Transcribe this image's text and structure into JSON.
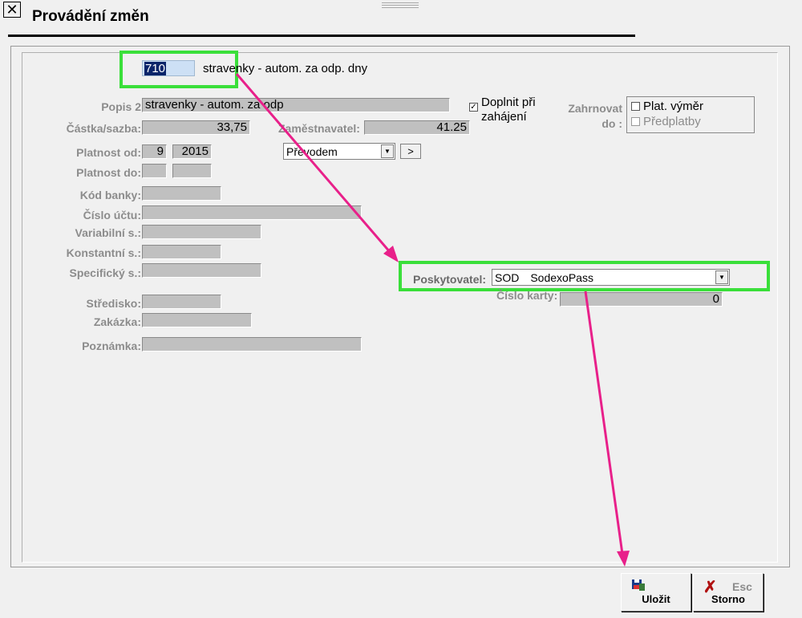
{
  "window": {
    "title": "Provádění změn",
    "close_glyph": "✕"
  },
  "form": {
    "code": "710",
    "code_desc": "stravenky - autom. za odp. dny",
    "popis2_label": "Popis 2",
    "popis2_value": "stravenky - autom. za odp",
    "castka_label": "Částka/sazba:",
    "castka_value": "33,75",
    "zamestnavatel_label": "Zaměstnavatel:",
    "zamestnavatel_value": "41.25",
    "platnost_od_label": "Platnost od:",
    "platnost_od_month": "9",
    "platnost_od_year": "2015",
    "platnost_do_label": "Platnost do:",
    "platnost_do_month": "",
    "platnost_do_year": "",
    "payment_select": "Převodem",
    "next_btn": ">",
    "doplnit_label_1": "Doplnit při",
    "doplnit_label_2": "zahájení",
    "doplnit_checked": "✓",
    "zahrnovat_label_1": "Zahrnovat",
    "zahrnovat_label_2": "do :",
    "plat_vymer": "Plat. výměr",
    "predplatby": "Předplatby",
    "kod_banky_label": "Kód banky:",
    "cislo_uctu_label": "Číslo účtu:",
    "variabilni_label": "Variabilní s.:",
    "konstantni_label": "Konstantní s.:",
    "specificky_label": "Specifický s.:",
    "stredisko_label": "Středisko:",
    "zakazka_label": "Zakázka:",
    "poznamka_label": "Poznámka:",
    "poskytovatel_label": "Poskytovatel:",
    "poskytovatel_code": "SOD",
    "poskytovatel_name": "SodexoPass",
    "cislo_karty_label": "Číslo karty:",
    "cislo_karty_value": "0"
  },
  "buttons": {
    "save": "Uložit",
    "cancel": "Storno",
    "cancel_hotkey": "Esc"
  },
  "colors": {
    "highlight": "#3adf3a",
    "arrow": "#e8208a",
    "field": "#c0c0c0",
    "label": "#8c8c8c"
  }
}
